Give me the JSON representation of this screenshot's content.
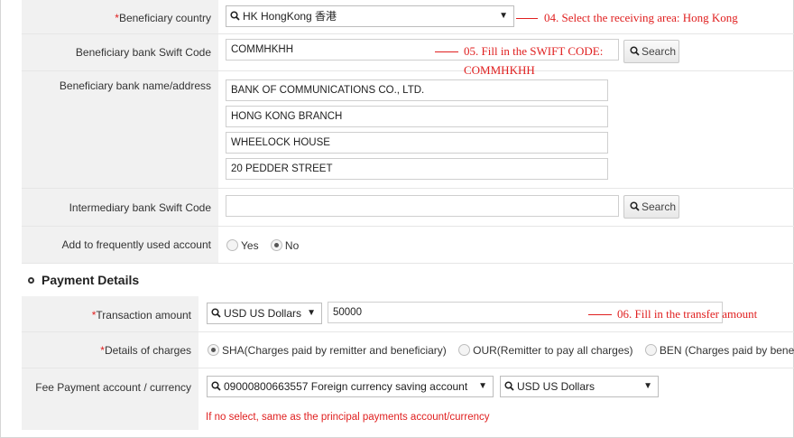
{
  "beneficiary_country": {
    "label": "Beneficiary country",
    "value": "HK HongKong 香港",
    "annotation": "04. Select the receiving area: Hong Kong"
  },
  "swift_code": {
    "label": "Beneficiary bank Swift Code",
    "value": "COMMHKHH",
    "search_label": "Search",
    "annotation_line1": "05. Fill in the SWIFT CODE:",
    "annotation_line2": "COMMHKHH"
  },
  "bank_address": {
    "label": "Beneficiary bank name/address",
    "lines": [
      "BANK OF COMMUNICATIONS CO., LTD.",
      "HONG KONG BRANCH",
      "WHEELOCK HOUSE",
      "20 PEDDER STREET"
    ]
  },
  "intermediary": {
    "label": "Intermediary bank Swift Code",
    "value": "",
    "search_label": "Search"
  },
  "frequent": {
    "label": "Add to frequently used account",
    "options": [
      "Yes",
      "No"
    ],
    "selected": "No"
  },
  "payment_details": {
    "title": "Payment Details"
  },
  "transaction": {
    "label": "Transaction amount",
    "currency": "USD US Dollars",
    "amount": "50000",
    "annotation": "06. Fill in the transfer amount"
  },
  "charges": {
    "label": "Details of charges",
    "options": [
      "SHA(Charges paid by remitter and beneficiary)",
      "OUR(Remitter to pay all charges)",
      "BEN (Charges paid by beneficiary)"
    ],
    "selected": "SHA(Charges paid by remitter and beneficiary)"
  },
  "fee_payment": {
    "label": "Fee Payment account / currency",
    "account": "09000800663557 Foreign currency saving account",
    "currency": "USD US Dollars",
    "note": "If no select, same as the principal payments account/currency"
  },
  "colors": {
    "accent": "#e02020",
    "label_bg": "#f1f1f1"
  },
  "icons": {
    "search": "magnifier-icon",
    "dropdown": "triangle-down-icon"
  }
}
